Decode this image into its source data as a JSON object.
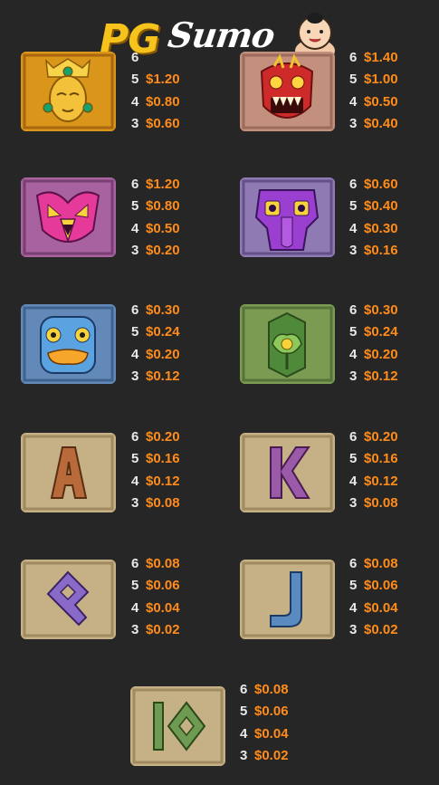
{
  "logo": {
    "brand": "PG",
    "game": "Sumo"
  },
  "symbols": [
    {
      "id": "golden-mask",
      "payouts": [
        {
          "count": "6",
          "value": ""
        },
        {
          "count": "5",
          "value": "$1.20"
        },
        {
          "count": "4",
          "value": "$0.80"
        },
        {
          "count": "3",
          "value": "$0.60"
        }
      ]
    },
    {
      "id": "red-demon-mask",
      "payouts": [
        {
          "count": "6",
          "value": "$1.40"
        },
        {
          "count": "5",
          "value": "$1.00"
        },
        {
          "count": "4",
          "value": "$0.50"
        },
        {
          "count": "3",
          "value": "$0.40"
        }
      ]
    },
    {
      "id": "pink-owl-mask",
      "payouts": [
        {
          "count": "6",
          "value": "$1.20"
        },
        {
          "count": "5",
          "value": "$0.80"
        },
        {
          "count": "4",
          "value": "$0.50"
        },
        {
          "count": "3",
          "value": "$0.20"
        }
      ]
    },
    {
      "id": "purple-mask",
      "payouts": [
        {
          "count": "6",
          "value": "$0.60"
        },
        {
          "count": "5",
          "value": "$0.40"
        },
        {
          "count": "4",
          "value": "$0.30"
        },
        {
          "count": "3",
          "value": "$0.16"
        }
      ]
    },
    {
      "id": "blue-frog-mask",
      "payouts": [
        {
          "count": "6",
          "value": "$0.30"
        },
        {
          "count": "5",
          "value": "$0.24"
        },
        {
          "count": "4",
          "value": "$0.20"
        },
        {
          "count": "3",
          "value": "$0.12"
        }
      ]
    },
    {
      "id": "green-jade-flower",
      "payouts": [
        {
          "count": "6",
          "value": "$0.30"
        },
        {
          "count": "5",
          "value": "$0.24"
        },
        {
          "count": "4",
          "value": "$0.20"
        },
        {
          "count": "3",
          "value": "$0.12"
        }
      ]
    },
    {
      "id": "letter-a",
      "glyph": "A",
      "payouts": [
        {
          "count": "6",
          "value": "$0.20"
        },
        {
          "count": "5",
          "value": "$0.16"
        },
        {
          "count": "4",
          "value": "$0.12"
        },
        {
          "count": "3",
          "value": "$0.08"
        }
      ]
    },
    {
      "id": "letter-k",
      "glyph": "K",
      "payouts": [
        {
          "count": "6",
          "value": "$0.20"
        },
        {
          "count": "5",
          "value": "$0.16"
        },
        {
          "count": "4",
          "value": "$0.12"
        },
        {
          "count": "3",
          "value": "$0.08"
        }
      ]
    },
    {
      "id": "letter-q",
      "glyph": "Q",
      "payouts": [
        {
          "count": "6",
          "value": "$0.08"
        },
        {
          "count": "5",
          "value": "$0.06"
        },
        {
          "count": "4",
          "value": "$0.04"
        },
        {
          "count": "3",
          "value": "$0.02"
        }
      ]
    },
    {
      "id": "letter-j",
      "glyph": "J",
      "payouts": [
        {
          "count": "6",
          "value": "$0.08"
        },
        {
          "count": "5",
          "value": "$0.06"
        },
        {
          "count": "4",
          "value": "$0.04"
        },
        {
          "count": "3",
          "value": "$0.02"
        }
      ]
    },
    {
      "id": "number-10",
      "glyph": "10",
      "payouts": [
        {
          "count": "6",
          "value": "$0.08"
        },
        {
          "count": "5",
          "value": "$0.06"
        },
        {
          "count": "4",
          "value": "$0.04"
        },
        {
          "count": "3",
          "value": "$0.02"
        }
      ]
    }
  ],
  "colors": {
    "background": "#262626",
    "count_text": "#e9e9e9",
    "value_text": "#ff8c1a",
    "accent_gold": "#f6c21c"
  }
}
